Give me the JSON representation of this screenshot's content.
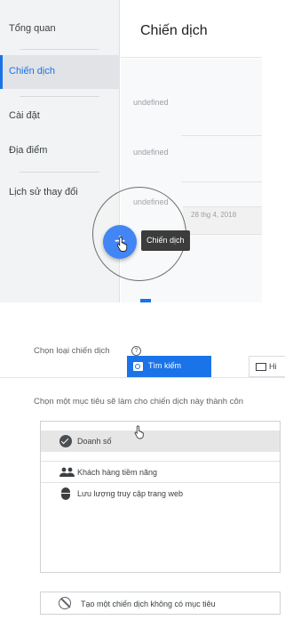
{
  "sidebar": {
    "items": [
      {
        "label": "Tổng quan"
      },
      {
        "label": "Chiến dịch"
      },
      {
        "label": "Cài đặt"
      },
      {
        "label": "Địa điểm"
      },
      {
        "label": "Lịch sử thay đổi"
      }
    ]
  },
  "header": {
    "title": "Chiến dịch"
  },
  "table": {
    "placeholders": [
      "undefined",
      "undefined",
      "undefined"
    ],
    "date": "28 thg 4, 2018"
  },
  "fab": {
    "symbol": "+",
    "tooltip": "Chiến dịch"
  },
  "campaign_type": {
    "label": "Chọn loại chiến dịch",
    "help_symbol": "?",
    "tabs": [
      {
        "label": "Tìm kiếm",
        "icon": "search-icon",
        "active": true
      },
      {
        "label": "Hi",
        "icon": "display-icon",
        "active": false
      }
    ]
  },
  "goals": {
    "prompt": "Chọn một mục tiêu sẽ làm cho chiến dịch này thành côn",
    "options": [
      {
        "label": "Doanh số",
        "icon": "check-circle-icon",
        "selected": true
      },
      {
        "label": "Khách hàng tiềm năng",
        "icon": "people-icon",
        "selected": false
      },
      {
        "label": "Lưu lượng truy cập trang web",
        "icon": "mouse-icon",
        "selected": false
      }
    ],
    "no_goal_label": "Tạo một chiến dịch không có mục tiêu"
  },
  "colors": {
    "accent": "#1a73e8",
    "fab": "#4285f4",
    "sidebar_bg": "#f1f3f4",
    "tooltip_bg": "#3c3c3c"
  }
}
